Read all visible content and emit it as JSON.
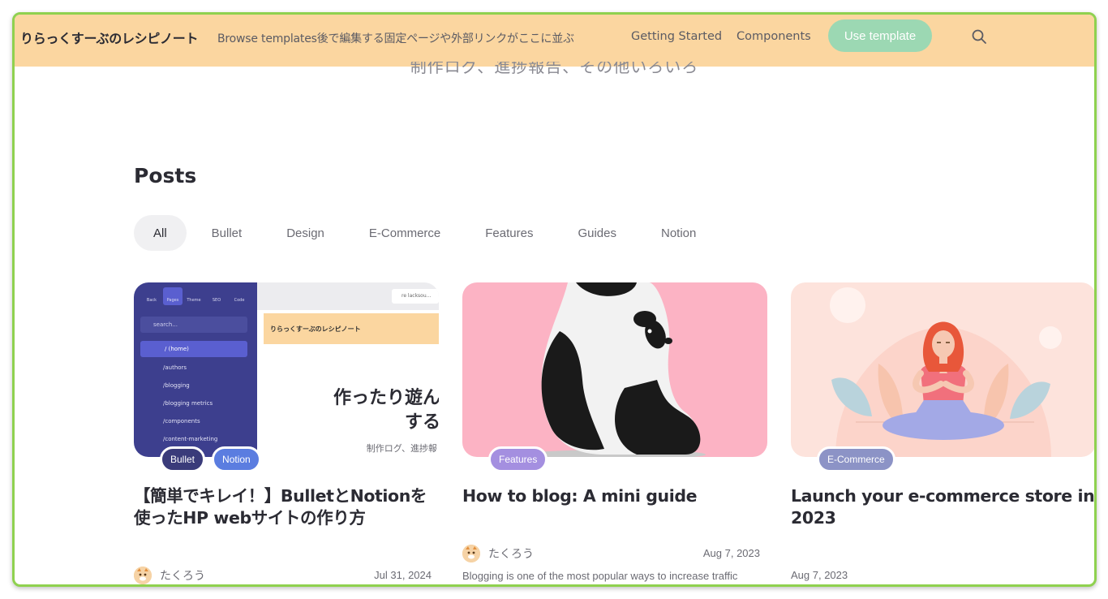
{
  "header": {
    "site_title": "りらっくすーぶのレシピノート",
    "nav": {
      "browse": "Browse templates後で編集する固定ページや外部リンクがここに並ぶ",
      "getting_started": "Getting Started",
      "components": "Components"
    },
    "cta": "Use template",
    "search_icon": "search-icon"
  },
  "tagline": "制作ログ、進捗報告、その他いろいろ",
  "posts": {
    "heading": "Posts",
    "filters": [
      "All",
      "Bullet",
      "Design",
      "E-Commerce",
      "Features",
      "Guides",
      "Notion"
    ],
    "active_filter": "All"
  },
  "cards": [
    {
      "tags": [
        {
          "label": "Bullet",
          "color": "#3a3b7a"
        },
        {
          "label": "Notion",
          "color": "#5b7de0"
        }
      ],
      "title": "【簡単でキレイ！】BulletとNotionを使ったHP webサイトの作り方",
      "author": "たくろう",
      "date": "Jul 31, 2024",
      "image": {
        "banner": "りらっくすーぶのレシピノート",
        "headline_1": "作ったり遊ん",
        "headline_2": "する",
        "subline": "制作ログ、進捗報",
        "search": "search...",
        "home": "/ (home)",
        "toolbar": [
          "Back",
          "Pages",
          "Theme",
          "SEO",
          "Code"
        ],
        "url": "re lacksou...",
        "pages": [
          "/authors",
          "/blogging",
          "/blogging metrics",
          "/components",
          "/content-marketing"
        ]
      }
    },
    {
      "tags": [
        {
          "label": "Features",
          "color": "#a48fe0"
        }
      ],
      "title": "How to blog: A mini guide",
      "author": "たくろう",
      "date": "Aug 7, 2023",
      "excerpt": "Blogging is one of the most popular ways to increase traffic"
    },
    {
      "tags": [
        {
          "label": "E-Commerce",
          "color": "#8c93c6"
        }
      ],
      "title": "Launch your e-commerce store in 2023",
      "date": "Aug 7, 2023"
    }
  ],
  "colors": {
    "header_bg": "#fbd6a0",
    "cta_bg": "#9cd8b3",
    "frame_border": "#8fd14f",
    "panda_bg": "#fcb3c4",
    "yoga_bg": "#fde3dc"
  }
}
